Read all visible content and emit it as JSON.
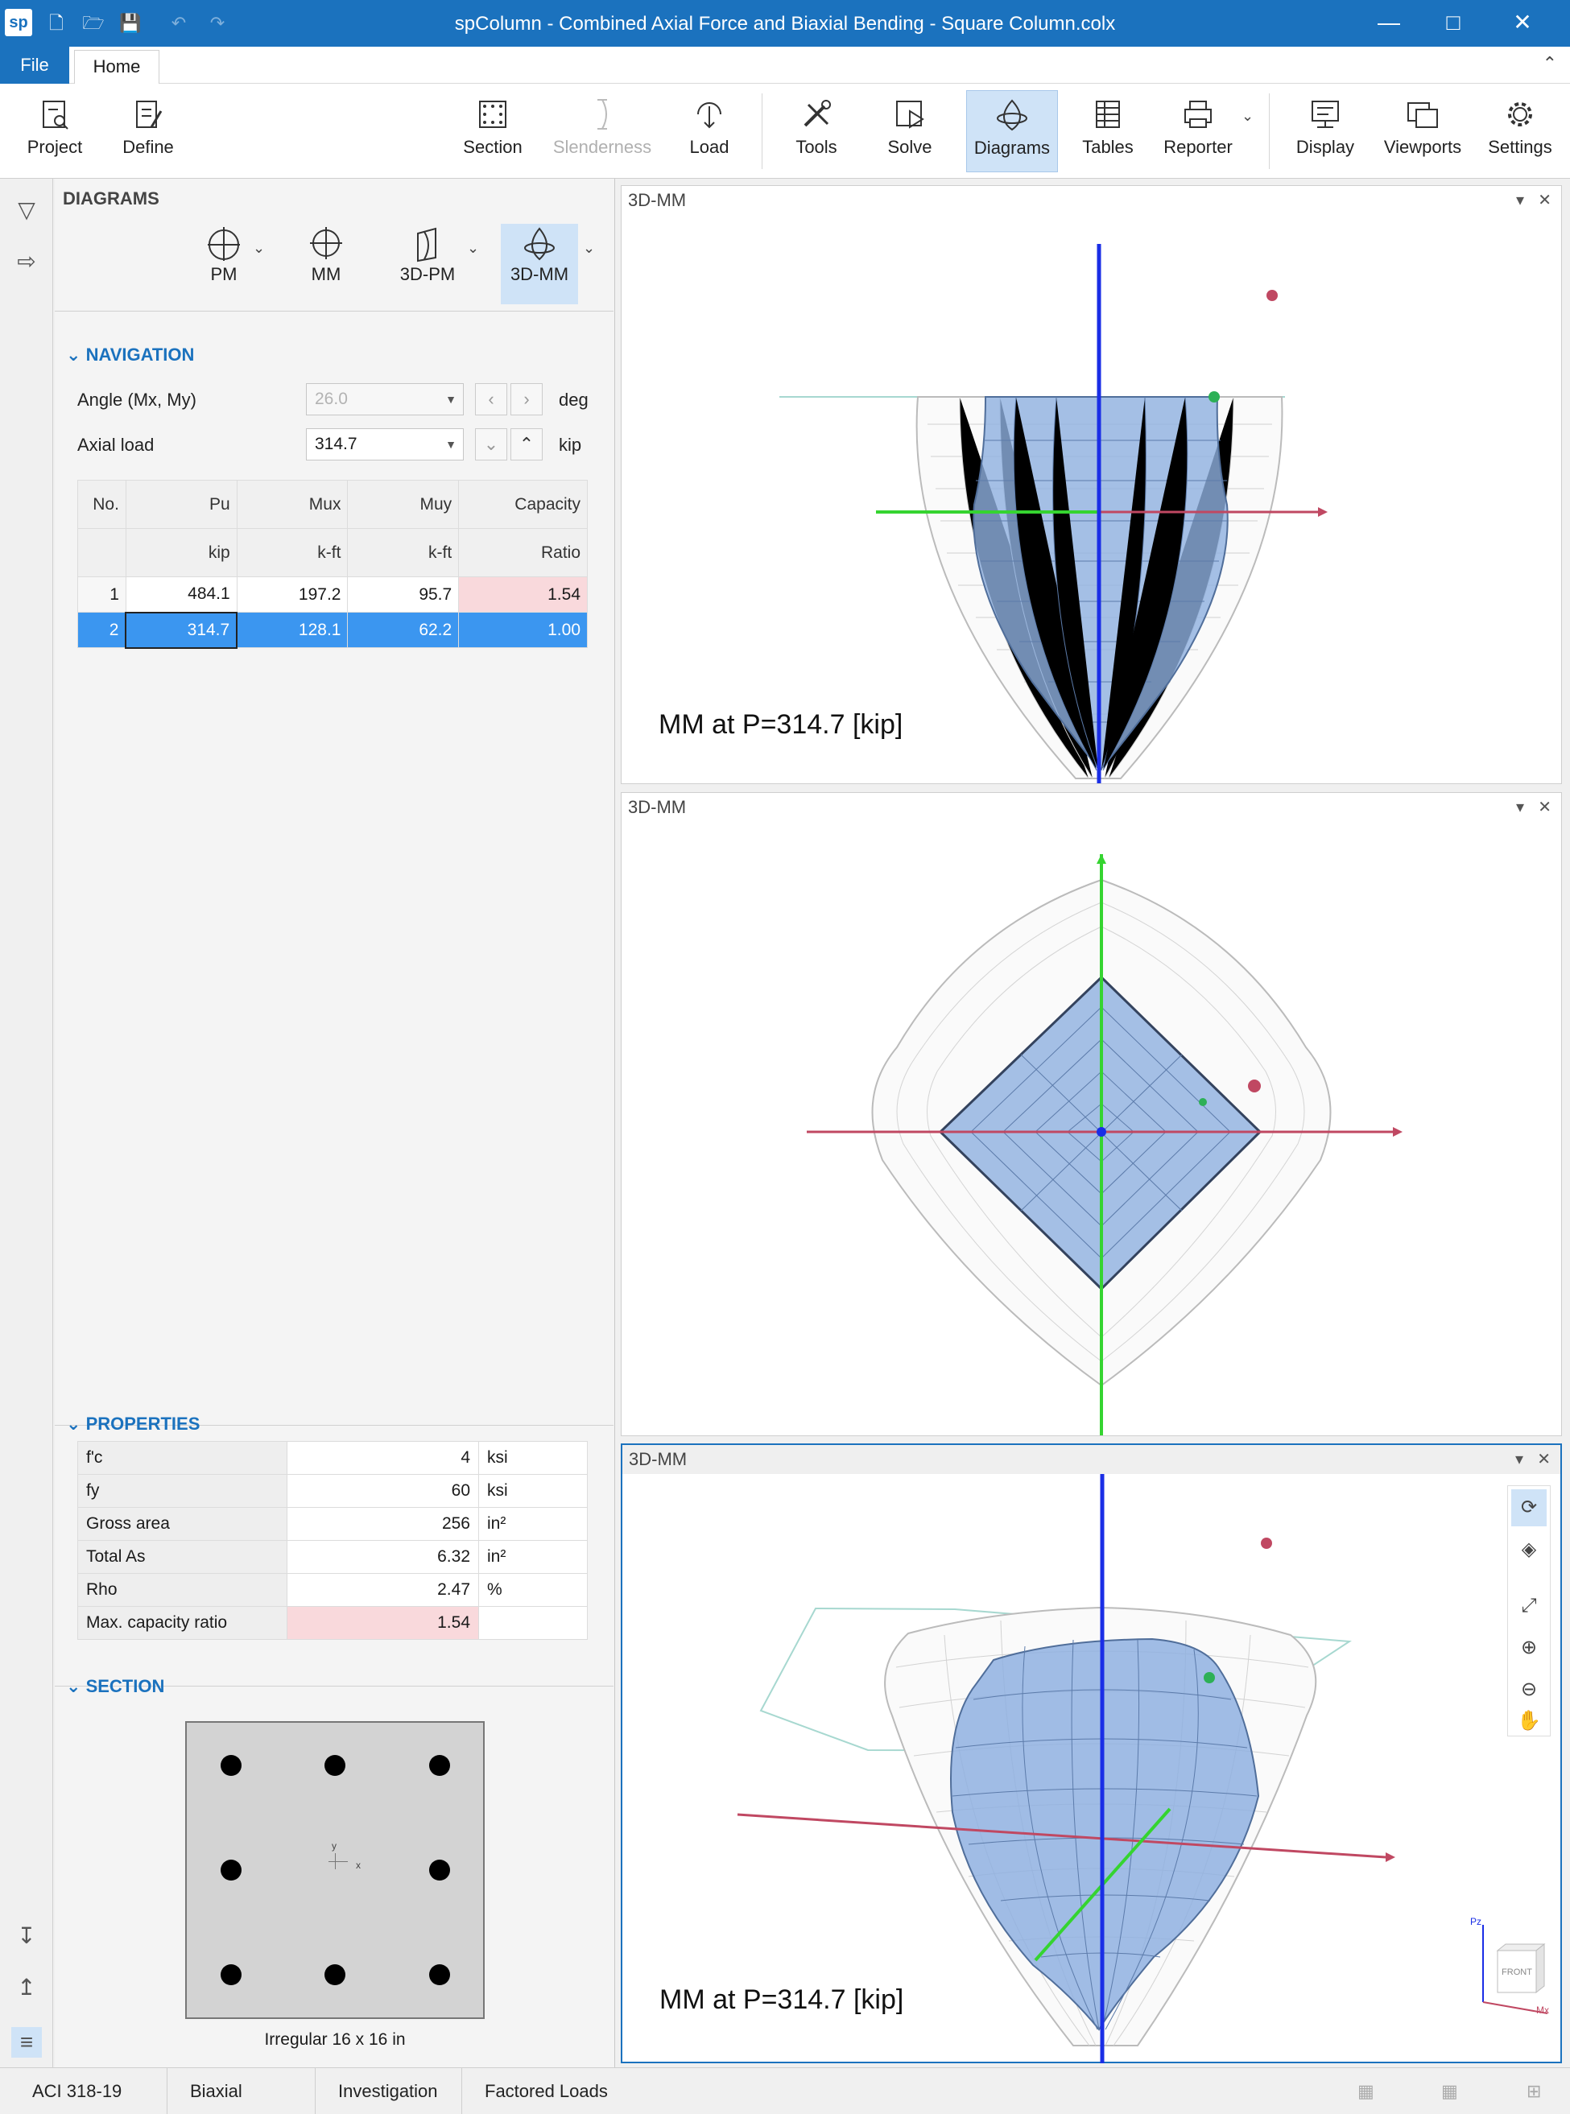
{
  "title": "spColumn - Combined Axial Force and Biaxial Bending - Square Column.colx",
  "logo": "sp",
  "menu": {
    "file": "File",
    "home": "Home"
  },
  "ribbon": {
    "project": "Project",
    "define": "Define",
    "section": "Section",
    "slenderness": "Slenderness",
    "load": "Load",
    "tools": "Tools",
    "solve": "Solve",
    "diagrams": "Diagrams",
    "tables": "Tables",
    "reporter": "Reporter",
    "display": "Display",
    "viewports": "Viewports",
    "settings": "Settings"
  },
  "panel": {
    "title": "DIAGRAMS",
    "diagram_buttons": {
      "pm": "PM",
      "mm": "MM",
      "pm3d": "3D-PM",
      "mm3d": "3D-MM"
    },
    "navigation": {
      "header": "NAVIGATION",
      "angle_label": "Angle (Mx, My)",
      "angle_value": "26.0",
      "angle_unit": "deg",
      "axial_label": "Axial load",
      "axial_value": "314.7",
      "axial_unit": "kip"
    },
    "table": {
      "headers": [
        "No.",
        "Pu",
        "Mux",
        "Muy",
        "Capacity"
      ],
      "units": [
        "",
        "kip",
        "k-ft",
        "k-ft",
        "Ratio"
      ],
      "rows": [
        [
          "1",
          "484.1",
          "197.2",
          "95.7",
          "1.54"
        ],
        [
          "2",
          "314.7",
          "128.1",
          "62.2",
          "1.00"
        ]
      ]
    },
    "properties": {
      "header": "PROPERTIES",
      "rows": [
        {
          "name": "f'c",
          "value": "4",
          "unit": "ksi"
        },
        {
          "name": "fy",
          "value": "60",
          "unit": "ksi"
        },
        {
          "name": "Gross area",
          "value": "256",
          "unit": "in²"
        },
        {
          "name": "Total As",
          "value": "6.32",
          "unit": "in²"
        },
        {
          "name": "Rho",
          "value": "2.47",
          "unit": "%"
        },
        {
          "name": "Max. capacity ratio",
          "value": "1.54",
          "unit": ""
        }
      ]
    },
    "section": {
      "header": "SECTION",
      "caption": "Irregular 16 x 16 in",
      "axis_y": "y",
      "axis_x": "x"
    }
  },
  "viewports": [
    {
      "title": "3D-MM",
      "label": "MM at P=314.7 [kip]"
    },
    {
      "title": "3D-MM",
      "label": ""
    },
    {
      "title": "3D-MM",
      "label": "MM at P=314.7 [kip]"
    }
  ],
  "navcube": {
    "face": "FRONT",
    "axis_z": "Pz",
    "axis_x": "Mx"
  },
  "status": [
    "ACI 318-19",
    "Biaxial",
    "Investigation",
    "Factored Loads"
  ],
  "colors": {
    "accent": "#1b72be",
    "selection": "#3b96f0",
    "warning": "#f9d9dc",
    "surface": "#8fb0e0"
  }
}
